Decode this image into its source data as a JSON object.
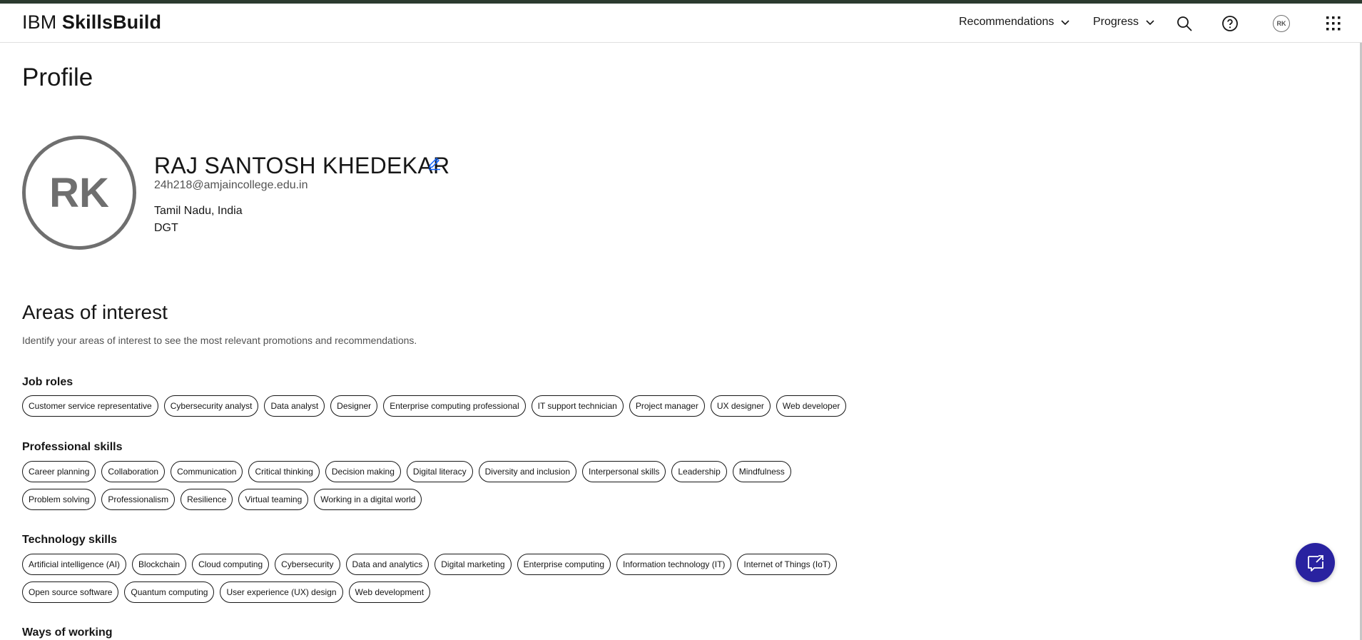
{
  "header": {
    "brand_ibm": "IBM",
    "brand_skills": "SkillsBuild",
    "nav": [
      {
        "label": "Recommendations"
      },
      {
        "label": "Progress"
      }
    ],
    "user_initials": "RK"
  },
  "profile": {
    "page_title": "Profile",
    "initials": "RK",
    "name": "RAJ SANTOSH KHEDEKAR",
    "email": "24h218@amjaincollege.edu.in",
    "location": "Tamil Nadu, India",
    "organization": "DGT"
  },
  "interests": {
    "title": "Areas of interest",
    "description": "Identify your areas of interest to see the most relevant promotions and recommendations.",
    "groups": [
      {
        "title": "Job roles",
        "chips": [
          "Customer service representative",
          "Cybersecurity analyst",
          "Data analyst",
          "Designer",
          "Enterprise computing professional",
          "IT support technician",
          "Project manager",
          "UX designer",
          "Web developer"
        ]
      },
      {
        "title": "Professional skills",
        "chips": [
          "Career planning",
          "Collaboration",
          "Communication",
          "Critical thinking",
          "Decision making",
          "Digital literacy",
          "Diversity and inclusion",
          "Interpersonal skills",
          "Leadership",
          "Mindfulness",
          "Problem solving",
          "Professionalism",
          "Resilience",
          "Virtual teaming",
          "Working in a digital world"
        ]
      },
      {
        "title": "Technology skills",
        "chips": [
          "Artificial intelligence (AI)",
          "Blockchain",
          "Cloud computing",
          "Cybersecurity",
          "Data and analytics",
          "Digital marketing",
          "Enterprise computing",
          "Information technology (IT)",
          "Internet of Things (IoT)",
          "Open source software",
          "Quantum computing",
          "User experience (UX) design",
          "Web development"
        ]
      },
      {
        "title": "Ways of working",
        "chips": []
      }
    ]
  },
  "colors": {
    "accent": "#0f62fe",
    "chat_button": "#2922a0",
    "top_stripe": "#2b3a2f"
  },
  "icons": {
    "search": "search-icon",
    "help": "help-icon",
    "apps": "app-switcher-icon",
    "edit": "edit-icon",
    "chat": "chat-icon"
  }
}
